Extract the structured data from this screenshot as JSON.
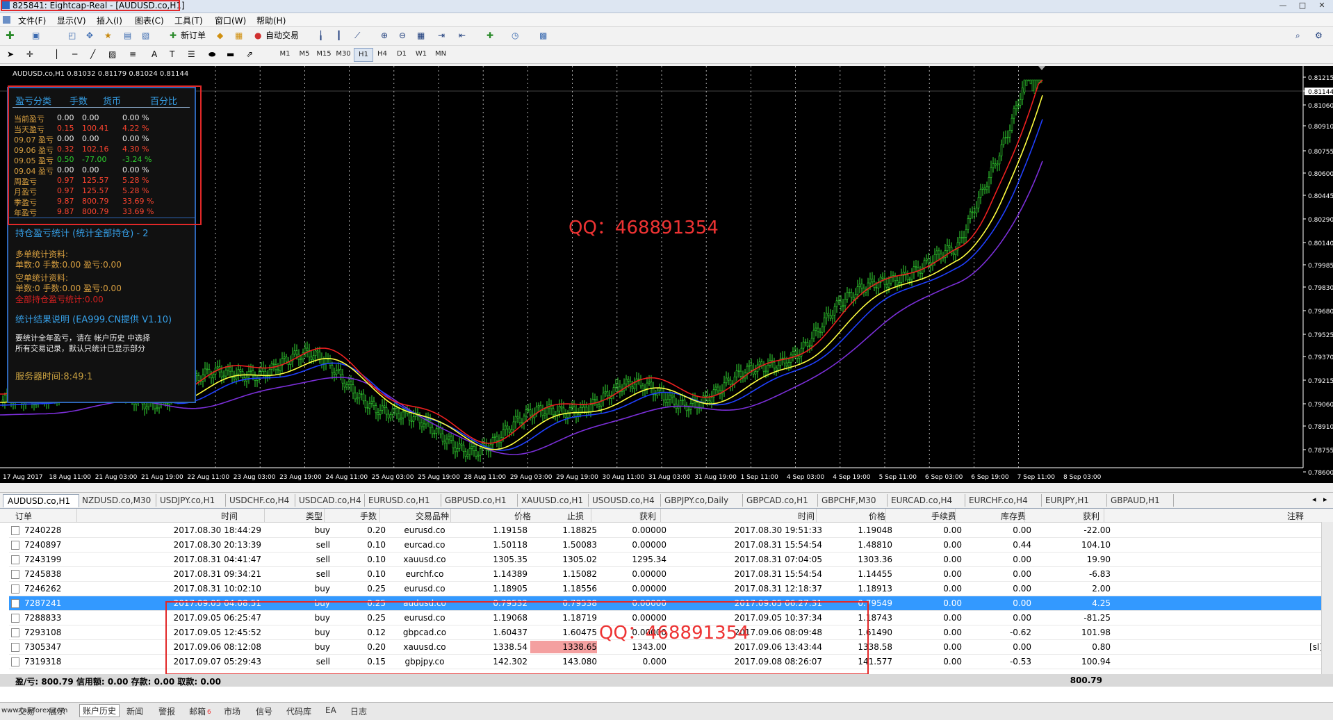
{
  "window": {
    "title": "825841: Eightcap-Real - [AUDUSD.co,H1]",
    "controls": [
      "—",
      "□",
      "✕"
    ]
  },
  "menu": [
    "文件(F)",
    "显示(V)",
    "插入(I)",
    "图表(C)",
    "工具(T)",
    "窗口(W)",
    "帮助(H)"
  ],
  "toolbar": {
    "new_order": "新订单",
    "auto_trade": "自动交易",
    "timeframes": [
      "M1",
      "M5",
      "M15",
      "M30",
      "H1",
      "H4",
      "D1",
      "W1",
      "MN"
    ]
  },
  "chart": {
    "header": "AUDUSD.co,H1  0.81032 0.81179 0.81024 0.81144",
    "price_labels": [
      "0.81215",
      "0.81144",
      "0.81060",
      "0.80910",
      "0.80755",
      "0.80600",
      "0.80445",
      "0.80290",
      "0.80140",
      "0.79985",
      "0.79830",
      "0.79680",
      "0.79525",
      "0.79370",
      "0.79215",
      "0.79060",
      "0.78910",
      "0.78755",
      "0.78600"
    ],
    "time_labels": [
      "17 Aug 2017",
      "18 Aug 11:00",
      "21 Aug 03:00",
      "21 Aug 19:00",
      "22 Aug 11:00",
      "23 Aug 03:00",
      "23 Aug 19:00",
      "24 Aug 11:00",
      "25 Aug 03:00",
      "25 Aug 19:00",
      "28 Aug 11:00",
      "29 Aug 03:00",
      "29 Aug 19:00",
      "30 Aug 11:00",
      "31 Aug 03:00",
      "31 Aug 19:00",
      "1 Sep 11:00",
      "4 Sep 03:00",
      "4 Sep 19:00",
      "5 Sep 11:00",
      "6 Sep 03:00",
      "6 Sep 19:00",
      "7 Sep 11:00",
      "8 Sep 03:00"
    ],
    "watermark": "QQ：468891354"
  },
  "panel": {
    "head": [
      "盈亏分类",
      "手数",
      "货币",
      "百分比"
    ],
    "rows": [
      {
        "label": "当前盈亏",
        "lots": "0.00",
        "money": "0.00",
        "pct": "0.00 %",
        "color": "white"
      },
      {
        "label": "当天盈亏",
        "lots": "0.15",
        "money": "100.41",
        "pct": "4.22 %",
        "color": "red"
      },
      {
        "label": "09.07 盈亏",
        "lots": "0.00",
        "money": "0.00",
        "pct": "0.00 %",
        "color": "white"
      },
      {
        "label": "09.06 盈亏",
        "lots": "0.32",
        "money": "102.16",
        "pct": "4.30 %",
        "color": "red"
      },
      {
        "label": "09.05 盈亏",
        "lots": "0.50",
        "money": "-77.00",
        "pct": "-3.24 %",
        "color": "green"
      },
      {
        "label": "09.04 盈亏",
        "lots": "0.00",
        "money": "0.00",
        "pct": "0.00 %",
        "color": "white"
      },
      {
        "label": "周盈亏",
        "lots": "0.97",
        "money": "125.57",
        "pct": "5.28 %",
        "color": "red"
      },
      {
        "label": "月盈亏",
        "lots": "0.97",
        "money": "125.57",
        "pct": "5.28 %",
        "color": "red"
      },
      {
        "label": "季盈亏",
        "lots": "9.87",
        "money": "800.79",
        "pct": "33.69 %",
        "color": "red"
      },
      {
        "label": "年盈亏",
        "lots": "9.87",
        "money": "800.79",
        "pct": "33.69 %",
        "color": "red"
      }
    ],
    "positions_title": "持仓盈亏统计 (统计全部持仓) - 2",
    "long_title": "多单统计资料:",
    "long_line": "单数:0    手数:0.00    盈亏:0.00",
    "short_title": "空单统计资料:",
    "short_line": "单数:0    手数:0.00    盈亏:0.00",
    "all_line": "全部持仓盈亏统计:0.00",
    "explain_title": "统计结果说明 (EA999.CN提供 V1.10)",
    "explain_1": "要统计全年盈亏，请在 帐户历史 中选择",
    "explain_2": "所有交易记录，默认只统计已显示部分",
    "server_time": "服务器时间:8:49:1"
  },
  "symbol_tabs": [
    "AUDUSD.co,H1",
    "NZDUSD.co,M30",
    "USDJPY.co,H1",
    "USDCHF.co,H4",
    "USDCAD.co,H4",
    "EURUSD.co,H1",
    "GBPUSD.co,H1",
    "XAUUSD.co,H1",
    "USOUSD.co,H4",
    "GBPJPY.co,Daily",
    "GBPCAD.co,H1",
    "GBPCHF,M30",
    "EURCAD.co,H4",
    "EURCHF.co,H4",
    "EURJPY,H1",
    "GBPAUD,H1"
  ],
  "table": {
    "headers": [
      "订单",
      "时间",
      "类型",
      "手数",
      "交易品种",
      "价格",
      "止损",
      "获利",
      "时间",
      "价格",
      "手续费",
      "库存费",
      "获利",
      "注释"
    ],
    "rows": [
      {
        "order": "7240228",
        "time": "2017.08.30 18:44:29",
        "type": "buy",
        "lots": "0.20",
        "symbol": "eurusd.co",
        "price": "1.19158",
        "sl": "1.18825",
        "tp": "0.00000",
        "ctime": "2017.08.30 19:51:33",
        "cprice": "1.19048",
        "comm": "0.00",
        "swap": "0.00",
        "profit": "-22.00",
        "comment": ""
      },
      {
        "order": "7240897",
        "time": "2017.08.30 20:13:39",
        "type": "sell",
        "lots": "0.10",
        "symbol": "eurcad.co",
        "price": "1.50118",
        "sl": "1.50083",
        "tp": "0.00000",
        "ctime": "2017.08.31 15:54:54",
        "cprice": "1.48810",
        "comm": "0.00",
        "swap": "0.44",
        "profit": "104.10",
        "comment": ""
      },
      {
        "order": "7243199",
        "time": "2017.08.31 04:41:47",
        "type": "sell",
        "lots": "0.10",
        "symbol": "xauusd.co",
        "price": "1305.35",
        "sl": "1305.02",
        "tp": "1295.34",
        "ctime": "2017.08.31 07:04:05",
        "cprice": "1303.36",
        "comm": "0.00",
        "swap": "0.00",
        "profit": "19.90",
        "comment": ""
      },
      {
        "order": "7245838",
        "time": "2017.08.31 09:34:21",
        "type": "sell",
        "lots": "0.10",
        "symbol": "eurchf.co",
        "price": "1.14389",
        "sl": "1.15082",
        "tp": "0.00000",
        "ctime": "2017.08.31 15:54:54",
        "cprice": "1.14455",
        "comm": "0.00",
        "swap": "0.00",
        "profit": "-6.83",
        "comment": ""
      },
      {
        "order": "7246262",
        "time": "2017.08.31 10:02:10",
        "type": "buy",
        "lots": "0.25",
        "symbol": "eurusd.co",
        "price": "1.18905",
        "sl": "1.18556",
        "tp": "0.00000",
        "ctime": "2017.08.31 12:18:37",
        "cprice": "1.18913",
        "comm": "0.00",
        "swap": "0.00",
        "profit": "2.00",
        "comment": ""
      },
      {
        "order": "7287241",
        "time": "2017.09.05 04:08:51",
        "type": "buy",
        "lots": "0.25",
        "symbol": "audusd.co",
        "price": "0.79532",
        "sl": "0.79538",
        "tp": "0.00000",
        "ctime": "2017.09.05 06:27:31",
        "cprice": "0.79549",
        "comm": "0.00",
        "swap": "0.00",
        "profit": "4.25",
        "comment": ""
      },
      {
        "order": "7288833",
        "time": "2017.09.05 06:25:47",
        "type": "buy",
        "lots": "0.25",
        "symbol": "eurusd.co",
        "price": "1.19068",
        "sl": "1.18719",
        "tp": "0.00000",
        "ctime": "2017.09.05 10:37:34",
        "cprice": "1.18743",
        "comm": "0.00",
        "swap": "0.00",
        "profit": "-81.25",
        "comment": ""
      },
      {
        "order": "7293108",
        "time": "2017.09.05 12:45:52",
        "type": "buy",
        "lots": "0.12",
        "symbol": "gbpcad.co",
        "price": "1.60437",
        "sl": "1.60475",
        "tp": "0.00000",
        "ctime": "2017.09.06 08:09:48",
        "cprice": "1.61490",
        "comm": "0.00",
        "swap": "-0.62",
        "profit": "101.98",
        "comment": ""
      },
      {
        "order": "7305347",
        "time": "2017.09.06 08:12:08",
        "type": "buy",
        "lots": "0.20",
        "symbol": "xauusd.co",
        "price": "1338.54",
        "sl": "1338.65",
        "tp": "1343.00",
        "ctime": "2017.09.06 13:43:44",
        "cprice": "1338.58",
        "comm": "0.00",
        "swap": "0.00",
        "profit": "0.80",
        "comment": "[sl]"
      },
      {
        "order": "7319318",
        "time": "2017.09.07 05:29:43",
        "type": "sell",
        "lots": "0.15",
        "symbol": "gbpjpy.co",
        "price": "142.302",
        "sl": "143.080",
        "tp": "0.000",
        "ctime": "2017.09.08 08:26:07",
        "cprice": "141.577",
        "comm": "0.00",
        "swap": "-0.53",
        "profit": "100.94",
        "comment": ""
      }
    ],
    "summary_left": "盈/亏: 800.79  信用额: 0.00  存款: 0.00  取款: 0.00",
    "summary_total": "800.79",
    "watermark": "QQ：468891354"
  },
  "bottom_tabs": [
    "交易",
    "展示",
    "账户历史",
    "新闻",
    "警报",
    "邮箱",
    "市场",
    "信号",
    "代码库",
    "EA",
    "日志"
  ],
  "mailbox_count": "6",
  "site": "www.talkforex.com"
}
